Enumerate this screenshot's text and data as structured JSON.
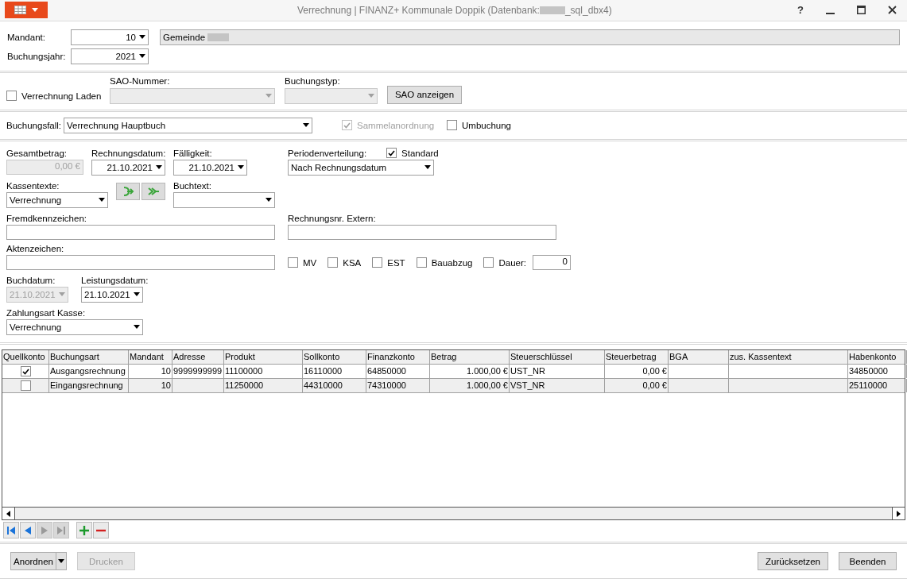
{
  "window": {
    "title_before": "Verrechnung | FINANZ+ Kommunale Doppik (Datenbank: ",
    "title_after": "_sql_dbx4)",
    "help": "?"
  },
  "header": {
    "mandant": {
      "label": "Mandant:",
      "value": "10"
    },
    "jahr": {
      "label": "Buchungsjahr:",
      "value": "2021"
    },
    "gemeinde": "Gemeinde"
  },
  "sao": {
    "laden": {
      "label": "Verrechnung Laden",
      "checked": false
    },
    "nummer_label": "SAO-Nummer:",
    "typ_label": "Buchungstyp:",
    "button": "SAO anzeigen"
  },
  "fall": {
    "label": "Buchungsfall:",
    "value": "Verrechnung Hauptbuch",
    "sammel": {
      "label": "Sammelanordnung",
      "checked": true,
      "disabled": true
    },
    "umbuchung": {
      "label": "Umbuchung",
      "checked": false,
      "disabled": false
    }
  },
  "form": {
    "gesamt": {
      "label": "Gesamtbetrag:",
      "value": "0,00 €"
    },
    "rdatum": {
      "label": "Rechnungsdatum:",
      "value": "21.10.2021"
    },
    "faellig": {
      "label": "Fälligkeit:",
      "value": "21.10.2021"
    },
    "perioden": {
      "label": "Periodenverteilung:",
      "value": "Nach Rechnungsdatum",
      "standard": {
        "label": "Standard",
        "checked": true
      }
    },
    "kassentexte": {
      "label": "Kassentexte:",
      "value": "Verrechnung"
    },
    "buchtext": {
      "label": "Buchtext:"
    },
    "fremd": {
      "label": "Fremdkennzeichen:"
    },
    "rnr": {
      "label": "Rechnungsnr. Extern:"
    },
    "akten": {
      "label": "Aktenzeichen:"
    },
    "flags": [
      {
        "label": "MV",
        "checked": false
      },
      {
        "label": "KSA",
        "checked": false
      },
      {
        "label": "EST",
        "checked": false
      },
      {
        "label": "Bauabzug",
        "checked": false
      },
      {
        "label": "Dauer:",
        "checked": false
      }
    ],
    "dauer": "0",
    "buchdatum": {
      "label": "Buchdatum:",
      "value": "21.10.2021",
      "disabled": true
    },
    "leistung": {
      "label": "Leistungsdatum:",
      "value": "21.10.2021",
      "disabled": false
    },
    "zahlungsart": {
      "label": "Zahlungsart Kasse:",
      "value": "Verrechnung"
    }
  },
  "table": {
    "columns": [
      "Quellkonto",
      "Buchungsart",
      "Mandant",
      "Adresse",
      "Produkt",
      "Sollkonto",
      "Finanzkonto",
      "Betrag",
      "Steuerschlüssel",
      "Steuerbetrag",
      "BGA",
      "zus. Kassentext",
      "Habenkonto"
    ],
    "rows": [
      {
        "selected": false,
        "cells": [
          {
            "kind": "checkbox",
            "checked": true
          },
          "Ausgangsrechnung",
          "10",
          "9999999999",
          "11100000",
          "16110000",
          "64850000",
          "1.000,00 €",
          "UST_NR",
          "0,00 €",
          "",
          "",
          "34850000"
        ]
      },
      {
        "selected": true,
        "cells": [
          {
            "kind": "checkbox",
            "checked": false
          },
          "Eingangsrechnung",
          "10",
          "",
          "11250000",
          "44310000",
          "74310000",
          "1.000,00 €",
          "VST_NR",
          "0,00 €",
          "",
          "",
          "25110000"
        ]
      }
    ]
  },
  "nav": [
    {
      "kind": "first",
      "disabled": false
    },
    {
      "kind": "prev",
      "disabled": false
    },
    {
      "kind": "next",
      "disabled": true
    },
    {
      "kind": "last",
      "disabled": true
    },
    {
      "kind": "add",
      "disabled": false
    },
    {
      "kind": "remove",
      "disabled": false
    }
  ],
  "buttons": [
    {
      "label": "Anordnen",
      "disabled": false
    },
    {
      "label": "Drucken",
      "disabled": true
    },
    {
      "label": "Zurücksetzen",
      "disabled": false
    },
    {
      "label": "Beenden",
      "disabled": false
    }
  ]
}
